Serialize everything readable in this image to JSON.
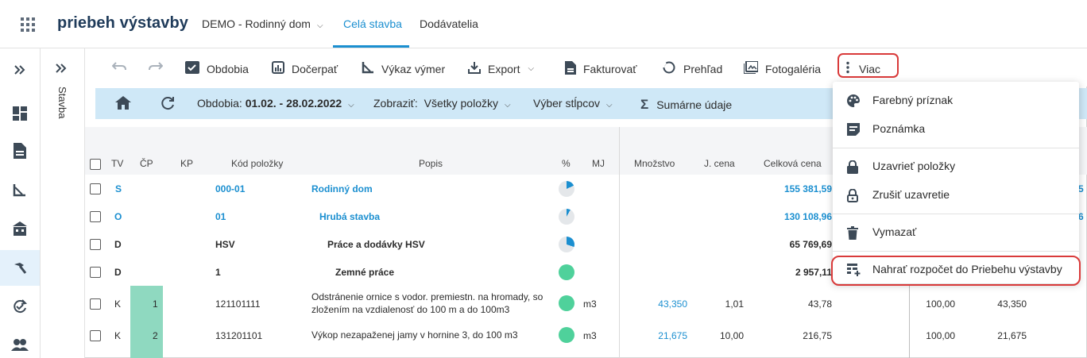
{
  "topbar": {
    "brand": "priebeh výstavby",
    "project": "DEMO - Rodinný dom",
    "tabs": [
      "Celá stavba",
      "Dodávatelia"
    ]
  },
  "stavba_label": "Stavba",
  "toolbar": {
    "obdobia": "Obdobia",
    "docerpat": "Dočerpať",
    "vykaz": "Výkaz výmer",
    "export": "Export",
    "fakturovat": "Fakturovať",
    "prehlad": "Prehľad",
    "fotogaleria": "Fotogaléria",
    "viac": "Viac"
  },
  "filterbar": {
    "obdobia_label": "Obdobia:",
    "obdobia_value": "01.02. - 28.02.2022",
    "zobrazit_label": "Zobraziť:",
    "zobrazit_value": "Všetky položky",
    "vyber": "Výber stĺpcov",
    "sumarne": "Sumárne údaje"
  },
  "table": {
    "headers": {
      "tv": "TV",
      "cp": "ČP",
      "kp": "KP",
      "kod": "Kód položky",
      "popis": "Popis",
      "pct": "%",
      "mj": "MJ",
      "mnozstvo": "Množstvo",
      "jcena": "J. cena",
      "celkova": "Celková cena"
    },
    "rows": [
      {
        "tv": "S",
        "cp": "",
        "kod": "000-01",
        "popis": "Rodinný dom",
        "mj": "",
        "mnozstvo": "",
        "jcena": "",
        "celkova": "155 381,59",
        "r1": "",
        "r2": "5"
      },
      {
        "tv": "O",
        "cp": "",
        "kod": "01",
        "popis": "Hrubá stavba",
        "mj": "",
        "mnozstvo": "",
        "jcena": "",
        "celkova": "130 108,96",
        "r1": "",
        "r2": "6"
      },
      {
        "tv": "D",
        "cp": "",
        "kod": "HSV",
        "popis": "Práce a dodávky HSV",
        "mj": "",
        "mnozstvo": "",
        "jcena": "",
        "celkova": "65 769,69",
        "r1": "",
        "r2": ""
      },
      {
        "tv": "D",
        "cp": "",
        "kod": "1",
        "popis": "Zemné práce",
        "mj": "",
        "mnozstvo": "",
        "jcena": "",
        "celkova": "2 957,11",
        "r1": "",
        "r2": ""
      },
      {
        "tv": "K",
        "cp": "1",
        "kod": "121101111",
        "popis": "Odstránenie ornice s vodor. premiestn. na hromady, so zložením na vzdialenosť do 100 m a do 100m3",
        "mj": "m3",
        "mnozstvo": "43,350",
        "jcena": "1,01",
        "celkova": "43,78",
        "r1": "100,00",
        "r2": "43,350"
      },
      {
        "tv": "K",
        "cp": "2",
        "kod": "131201101",
        "popis": "Výkop nezapaženej jamy v hornine 3, do 100 m3",
        "mj": "m3",
        "mnozstvo": "21,675",
        "jcena": "10,00",
        "celkova": "216,75",
        "r1": "100,00",
        "r2": "21,675"
      }
    ]
  },
  "menu": {
    "items": [
      "Farebný príznak",
      "Poznámka",
      "Uzavrieť položky",
      "Zrušiť uzavretie",
      "Vymazať",
      "Nahrať rozpočet do Priebehu výstavby"
    ]
  },
  "colors": {
    "accent": "#1b8fd0",
    "filterbar": "#cfe8f7",
    "highlight": "#d93a3a",
    "cp_fill": "#8fd9c0",
    "progress_full": "#4fd19b"
  }
}
